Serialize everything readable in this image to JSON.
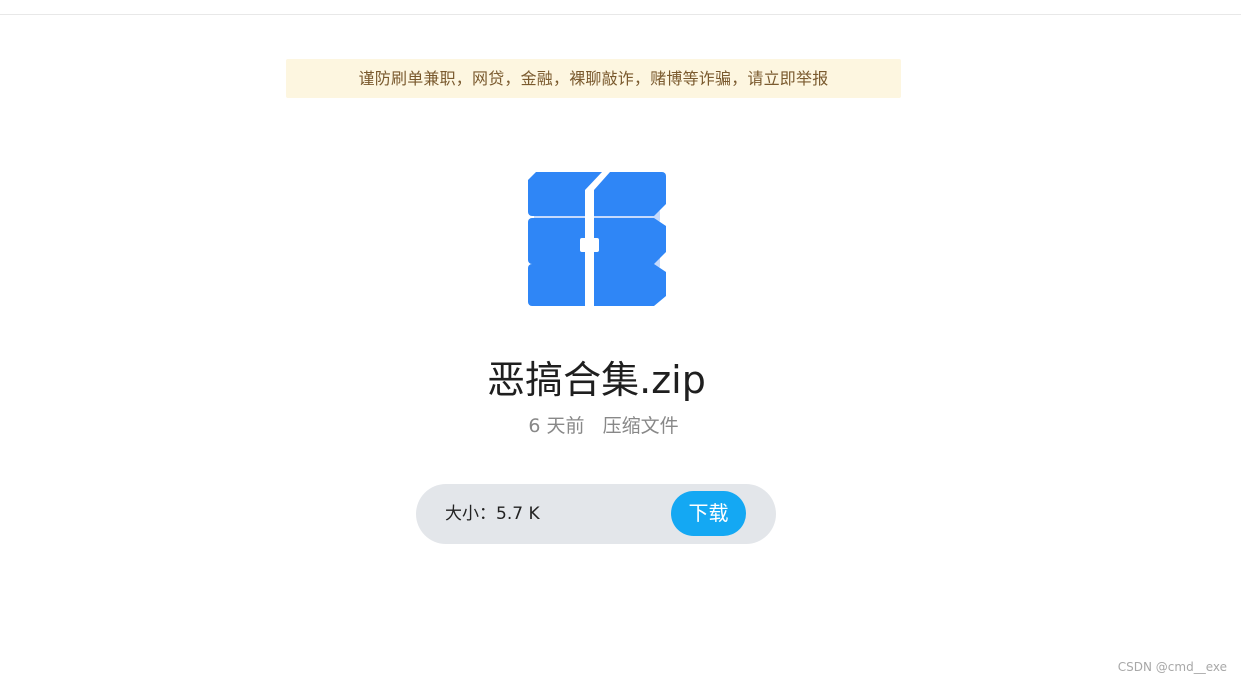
{
  "notice": {
    "text": "谨防刷单兼职，网贷，金融，裸聊敲诈，赌博等诈骗，请立即举报"
  },
  "file": {
    "icon": "archive-zip-icon",
    "name": "恶搞合集.zip",
    "time": "6 天前",
    "type": "压缩文件",
    "size_label": "大小：5.7 K"
  },
  "download": {
    "button_label": "下载"
  },
  "watermark": "CSDN @cmd__exe",
  "colors": {
    "icon_blue": "#2f86f6",
    "button_blue": "#14a8f3",
    "notice_bg": "#fdf6e0",
    "bar_bg": "#e3e6ea"
  }
}
